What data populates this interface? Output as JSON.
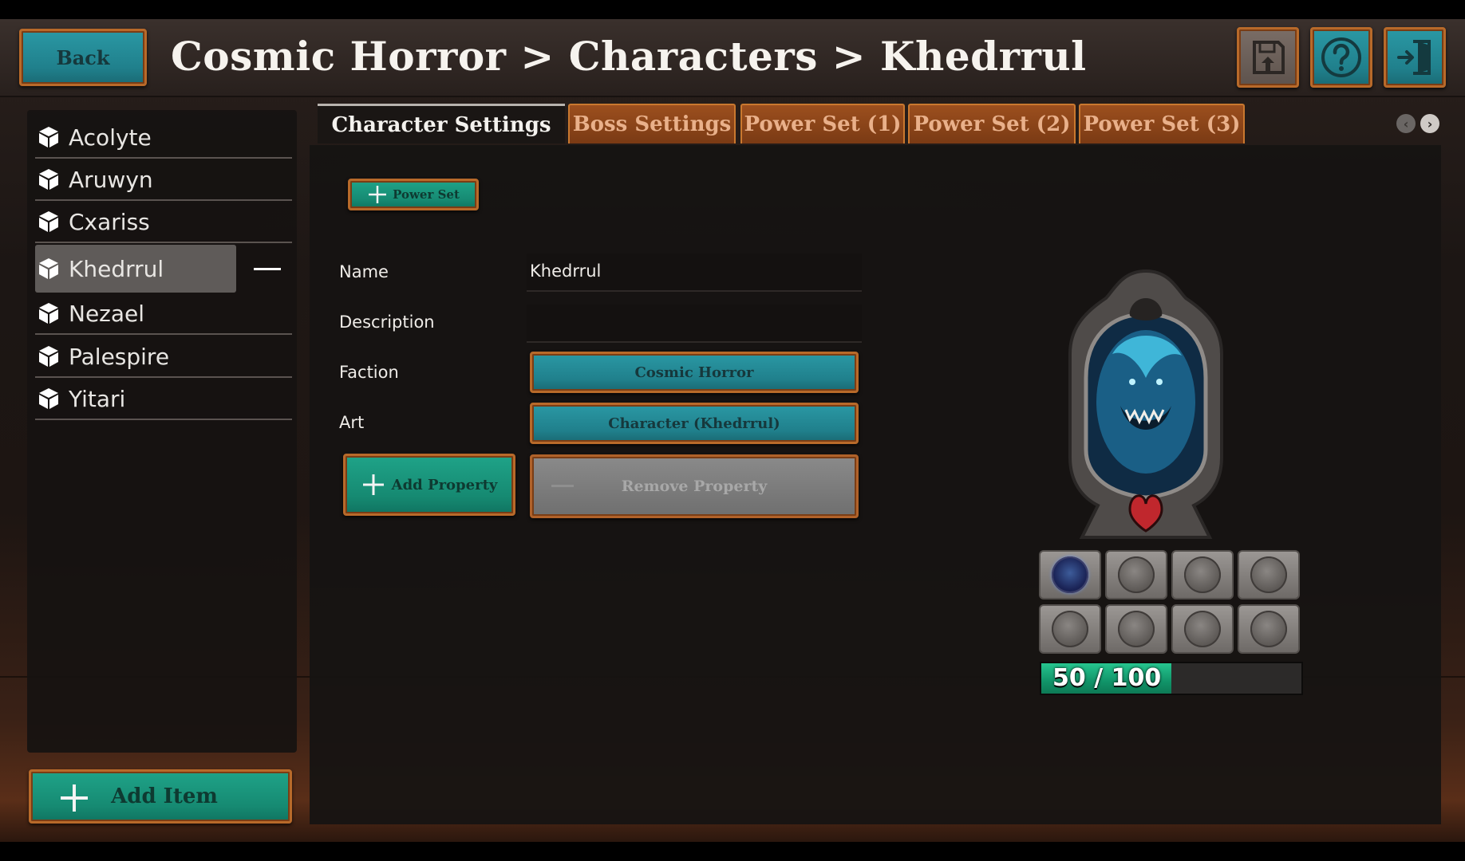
{
  "header": {
    "back_label": "Back",
    "title": "Cosmic Horror > Characters > Khedrrul",
    "icons": [
      "save-icon",
      "help-icon",
      "exit-icon"
    ]
  },
  "sidebar": {
    "items": [
      {
        "label": "Acolyte",
        "icon": "cube-icon"
      },
      {
        "label": "Aruwyn",
        "icon": "cube-icon"
      },
      {
        "label": "Cxariss",
        "icon": "cube-icon"
      },
      {
        "label": "Khedrrul",
        "icon": "cube-icon",
        "selected": true
      },
      {
        "label": "Nezael",
        "icon": "cube-icon"
      },
      {
        "label": "Palespire",
        "icon": "cube-icon"
      },
      {
        "label": "Yitari",
        "icon": "cube-icon"
      }
    ],
    "add_item_label": "Add Item"
  },
  "tabs": [
    {
      "label": "Character Settings",
      "active": true
    },
    {
      "label": "Boss Settings"
    },
    {
      "label": "Power Set (1)"
    },
    {
      "label": "Power Set (2)"
    },
    {
      "label": "Power Set (3)"
    }
  ],
  "form": {
    "add_power_set_label": "Power Set",
    "name_label": "Name",
    "name_value": "Khedrrul",
    "description_label": "Description",
    "description_value": "",
    "faction_label": "Faction",
    "faction_value": "Cosmic Horror",
    "art_label": "Art",
    "art_value": "Character (Khedrrul)",
    "add_property_label": "Add Property",
    "remove_property_label": "Remove Property"
  },
  "card": {
    "health_text": "50 / 100",
    "health_current": 50,
    "health_max": 100,
    "slots_filled": 1,
    "slots_total": 8
  },
  "colors": {
    "teal": "#20808c",
    "green": "#168a72",
    "wood": "#b86a2a",
    "health": "#119469"
  }
}
